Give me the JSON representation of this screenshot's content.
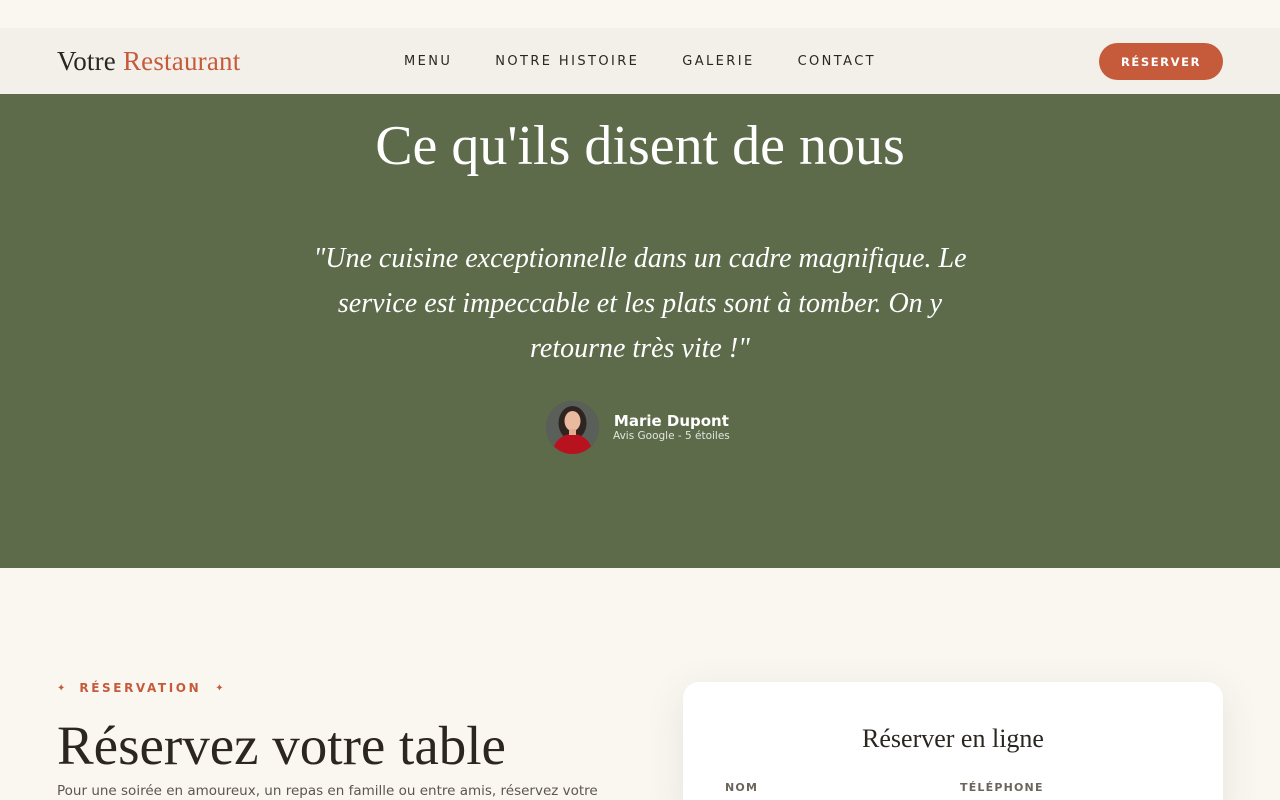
{
  "header": {
    "logo_part1": "Votre",
    "logo_part2": "Restaurant",
    "nav": [
      "MENU",
      "NOTRE HISTOIRE",
      "GALERIE",
      "CONTACT"
    ],
    "reserve_button": "RÉSERVER"
  },
  "testimonials": {
    "title": "Ce qu'ils disent de nous",
    "quote": "\"Une cuisine exceptionnelle dans un cadre magnifique. Le service est impeccable et les plats sont à tomber. On y retourne très vite !\"",
    "author_name": "Marie Dupont",
    "author_meta": "Avis Google - 5 étoiles"
  },
  "reservation": {
    "kicker": "RÉSERVATION",
    "title": "Réservez votre table",
    "description": "Pour une soirée en amoureux, un repas en famille ou entre amis, réservez votre",
    "card_title": "Réserver en ligne",
    "field_name_label": "NOM",
    "field_phone_label": "TÉLÉPHONE"
  },
  "colors": {
    "accent": "#c65b3c",
    "testimonial_bg": "#5d6b4b",
    "page_bg": "#faf7f1"
  }
}
